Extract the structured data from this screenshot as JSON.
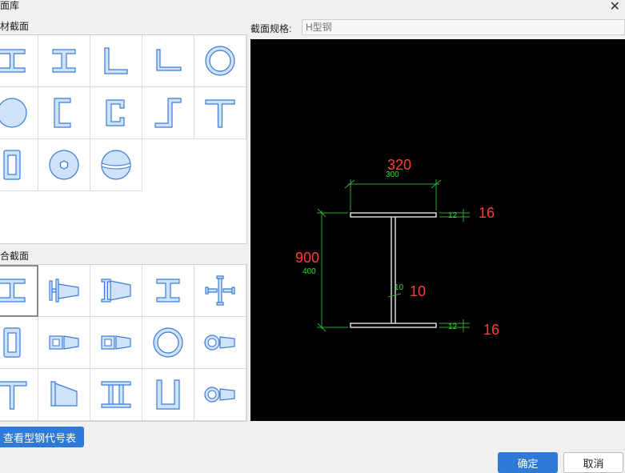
{
  "window": {
    "title": "面库"
  },
  "sections": {
    "standard_label": "材截面",
    "custom_label": "合截面"
  },
  "standard_shapes": [
    "h-beam-shape-icon",
    "i-beam-shape-icon",
    "angle-shape-icon",
    "unequal-angle-shape-icon",
    "pipe-shape-icon",
    "circle-shape-icon",
    "channel-shape-icon",
    "lipped-channel-shape-icon",
    "z-shape-icon",
    "t-shape-icon",
    "box-shape-icon",
    "bolt-shape-icon",
    "sphere-shape-icon"
  ],
  "custom_shapes": [
    "h-beam-shape-icon",
    "tapered-h-shape-icon",
    "tapered-i-shape-icon",
    "i-beam-shape-icon",
    "cross-h-shape-icon",
    "box-shape-icon",
    "box-tapered-shape-icon",
    "box-tapered-shape-icon",
    "pipe-shape-icon",
    "pipe-tapered-shape-icon",
    "t-shape-icon",
    "tapered-t-shape-icon",
    "double-channel-shape-icon",
    "u-shape-icon",
    "pipe-tapered-shape-icon"
  ],
  "spec": {
    "label": "截面规格:",
    "placeholder": "H型钢"
  },
  "drawing": {
    "width_label": "320",
    "width_dim": "300",
    "height_label": "900",
    "height_dim": "400",
    "web_label": "10",
    "web_dim": "10",
    "top_flange_label": "16",
    "top_flange_dim": "12",
    "bottom_flange_label": "16",
    "bottom_flange_dim": "12"
  },
  "colors": {
    "dim_red": "#ff3b3b",
    "dim_green": "#33dd33",
    "accent": "#2f7ad6"
  },
  "buttons": {
    "table_label": "查看型钢代号表",
    "ok_label": "确定",
    "cancel_label": "取消"
  }
}
